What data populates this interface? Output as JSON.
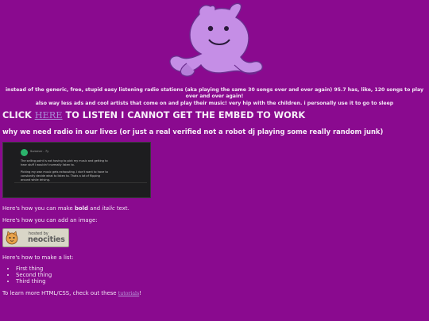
{
  "intro": {
    "line1": "instead of the generic, free, stupid easy listening radio stations (aka playing the same 30 songs over and over again) 95.7 has, like, 120 songs to play over and over again!",
    "line2": "also way less ads and cool artists that come on and play their music! very hip with the children. i personally use it to go to sleep"
  },
  "cta": {
    "before": "CLICK",
    "link": "HERE",
    "after": "TO LISTEN I CANNOT GET THE EMBED TO WORK"
  },
  "subheading": "why we need radio in our lives (or just a real verified not a robot dj playing some really random junk)",
  "embed_screenshot": {
    "name": "Summer - 7y",
    "para1": "The selling point is not having to pick my music and getting to hear stuff I wouldn't normally listen to.",
    "para2": "Picking my own music gets exhausting. I don't want to have to constantly decide what to listen to. Thats a lot of flipping around while driving."
  },
  "bold_line": {
    "before": "Here's how you can make",
    "bold": "bold",
    "mid": "and",
    "italic": "italic",
    "after": "text."
  },
  "image_line": "Here's how you can add an image:",
  "badge": {
    "small": "hosted by",
    "big": "neocities"
  },
  "list_intro": "Here's how to make a list:",
  "list_items": [
    "First thing",
    "Second thing",
    "Third thing"
  ],
  "learn": {
    "before": "To learn more HTML/CSS, check out these",
    "link": "tutorials",
    "after": "!"
  },
  "colors": {
    "background": "#8a0a8f",
    "mascot": "#c58ee6",
    "link": "#a98bd6"
  }
}
